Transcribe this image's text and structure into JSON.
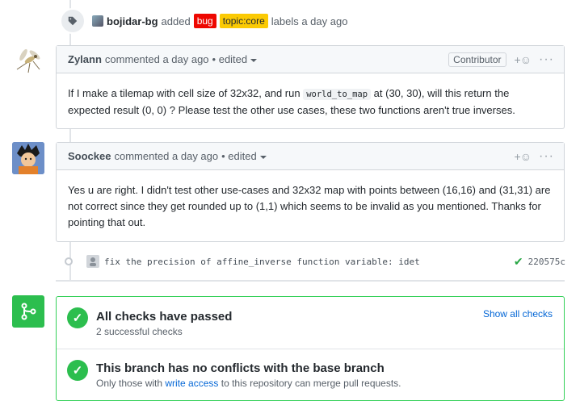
{
  "label_event": {
    "icon": "tag-icon",
    "user": "bojidar-bg",
    "action": "added",
    "labels": [
      {
        "name": "bug",
        "color": "#ee0701"
      },
      {
        "name": "topic:core",
        "color": "#fbca04"
      }
    ],
    "suffix": "labels a day ago"
  },
  "comments": [
    {
      "author": "Zylann",
      "meta": "commented a day ago",
      "edited": "• edited",
      "badge": "Contributor",
      "body_part1": "If I make a tilemap with cell size of 32x32, and run ",
      "body_code": "world_to_map",
      "body_part2": " at (30, 30), will this return the expected result (0, 0) ? Please test the other use cases, these two functions aren't true inverses."
    },
    {
      "author": "Soockee",
      "meta": "commented a day ago",
      "edited": "• edited",
      "body": "Yes u are right. I didn't test other use-cases and 32x32 map with points between (16,16) and (31,31) are not correct since they get rounded up to (1,1) which seems to be invalid as you mentioned. Thanks for pointing that out."
    }
  ],
  "commit": {
    "message": "fix the precision of affine_inverse function variable: idet",
    "sha": "220575c",
    "status_color": "#28a745"
  },
  "merge": {
    "checks_title": "All checks have passed",
    "checks_sub": "2 successful checks",
    "show_all": "Show all checks",
    "conflicts_title": "This branch has no conflicts with the base branch",
    "conflicts_sub_pre": "Only those with ",
    "conflicts_sub_link": "write access",
    "conflicts_sub_post": " to this repository can merge pull requests.",
    "accent": "#2cbe4e"
  },
  "reaction_icon": "+☺",
  "more_icon": "···"
}
